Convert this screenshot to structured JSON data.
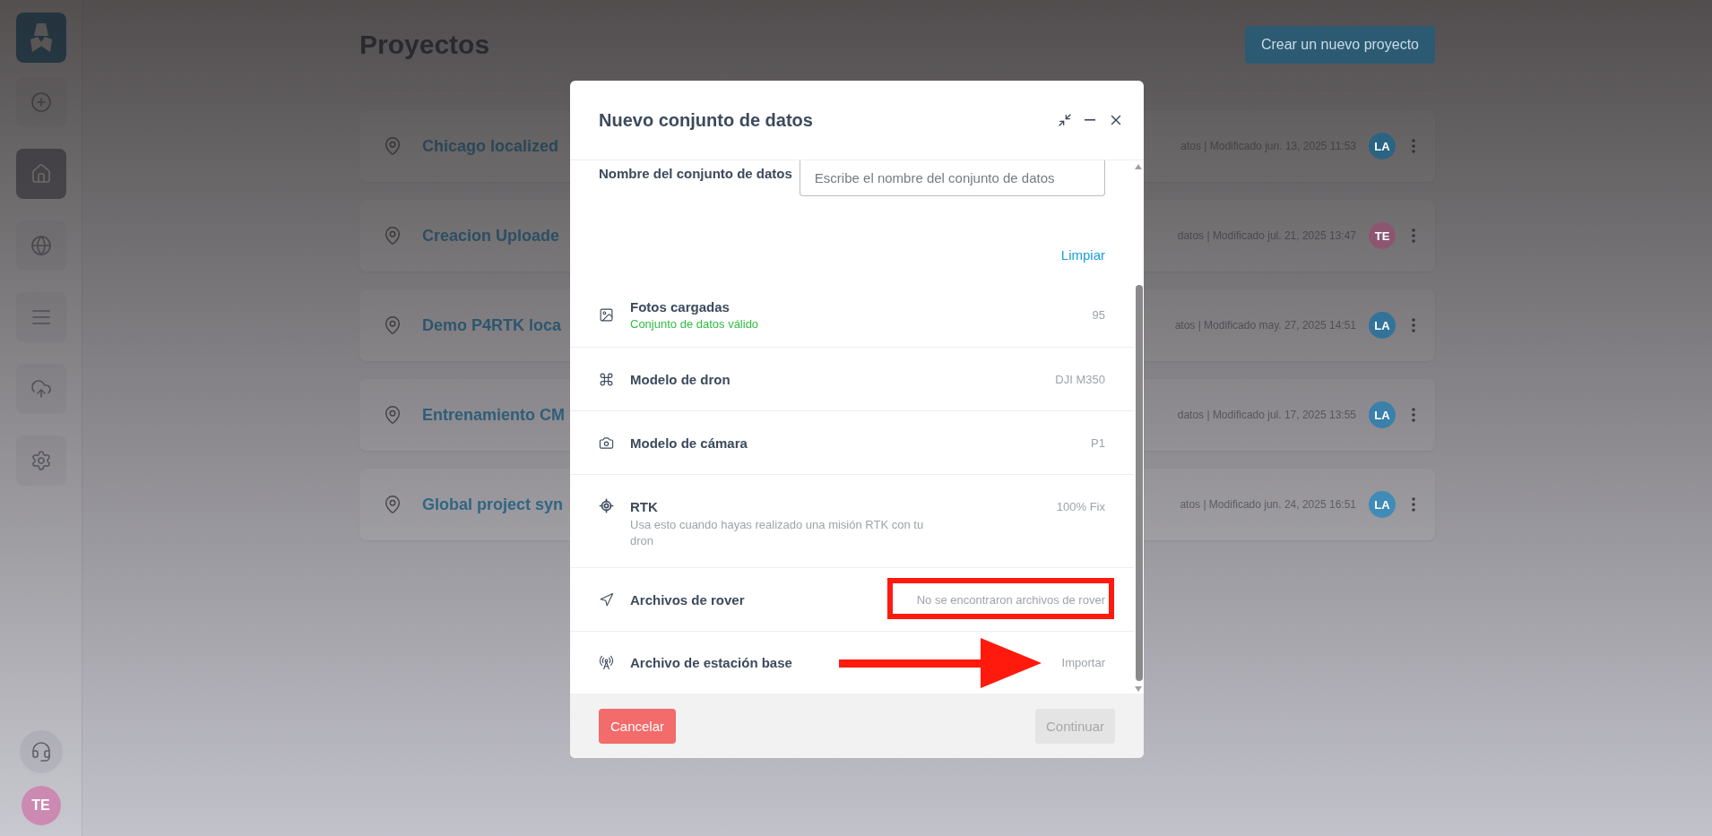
{
  "sidebar": {
    "items": [
      {
        "kind": "add",
        "selected": false
      },
      {
        "kind": "home",
        "selected": true
      },
      {
        "kind": "globe",
        "selected": false
      },
      {
        "kind": "list",
        "selected": false
      },
      {
        "kind": "upload",
        "selected": false
      },
      {
        "kind": "settings",
        "selected": false
      }
    ],
    "user": {
      "initials": "TE",
      "color": "#cc8ab3"
    }
  },
  "page": {
    "title": "Proyectos",
    "create_button": "Crear un nuevo proyecto"
  },
  "projects": [
    {
      "name": "Chicago localized",
      "meta": "atos | Modificado jun. 13, 2025 11:53",
      "owner": {
        "initials": "LA",
        "color": "#2b6483"
      }
    },
    {
      "name": "Creacion Uploade",
      "meta": "datos | Modificado jul. 21, 2025 13:47",
      "owner": {
        "initials": "TE",
        "color": "#8c5671"
      }
    },
    {
      "name": "Demo P4RTK loca",
      "meta": "atos | Modificado may. 27, 2025 14:51",
      "owner": {
        "initials": "LA",
        "color": "#33739a"
      }
    },
    {
      "name": "Entrenamiento CM",
      "meta": "datos | Modificado jul. 17, 2025 13:55",
      "owner": {
        "initials": "LA",
        "color": "#3a80aa"
      }
    },
    {
      "name": "Global project syn",
      "meta": "atos | Modificado jun. 24, 2025 16:51",
      "owner": {
        "initials": "LA",
        "color": "#408bb8"
      }
    }
  ],
  "dialog": {
    "title": "Nuevo conjunto de datos",
    "name_field": {
      "label": "Nombre del conjunto de datos",
      "placeholder": "Escribe el nombre del conjunto de datos"
    },
    "clear_link": "Limpiar",
    "rows": [
      {
        "kind": "photos",
        "label": "Fotos cargadas",
        "status": "Conjunto de datos válido",
        "value": "95"
      },
      {
        "kind": "drone",
        "label": "Modelo de dron",
        "value": "DJI M350"
      },
      {
        "kind": "camera",
        "label": "Modelo de cámara",
        "value": "P1"
      },
      {
        "kind": "rtk",
        "label": "RTK",
        "description": "Usa esto cuando hayas realizado una misión RTK con tu dron",
        "value": "100% Fix"
      },
      {
        "kind": "rover",
        "label": "Archivos de rover",
        "value": "No se encontraron archivos de rover",
        "highlight_box": true
      },
      {
        "kind": "base",
        "label": "Archivo de estación base",
        "value": "Importar",
        "pointer_arrow": true
      }
    ],
    "cancel_button": "Cancelar",
    "continue_button": {
      "label": "Continuar",
      "disabled": true
    }
  }
}
